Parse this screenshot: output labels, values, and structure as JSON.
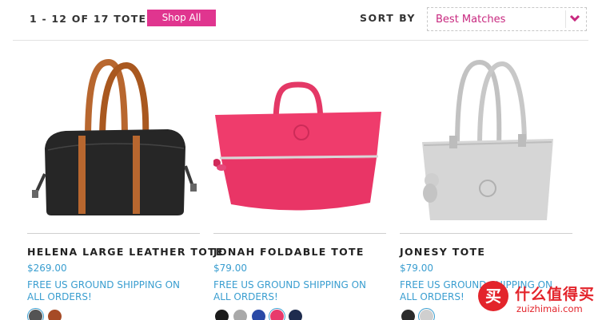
{
  "results": {
    "count_text": "1 - 12 OF 17 TOTES",
    "shop_all_label": "Shop All"
  },
  "sort": {
    "label": "SORT BY",
    "value": "Best Matches"
  },
  "colors": {
    "accent": "#e0358f",
    "link": "#3a9ed0"
  },
  "products": [
    {
      "name": "HELENA LARGE LEATHER TOTE",
      "price": "$269.00",
      "shipping": "FREE US GROUND SHIPPING ON ALL ORDERS!",
      "swatches": [
        "#545454",
        "#a64b26"
      ]
    },
    {
      "name": "JONAH FOLDABLE TOTE",
      "price": "$79.00",
      "shipping": "FREE US GROUND SHIPPING ON ALL ORDERS!",
      "swatches": [
        "#1b1b1b",
        "#a9a9a9",
        "#2a49a6",
        "#e83a6c",
        "#1e2c4e"
      ]
    },
    {
      "name": "JONESY TOTE",
      "price": "$79.00",
      "shipping": "FREE US GROUND SHIPPING ON ALL ORDERS!",
      "swatches": [
        "#2b2b2b",
        "#cfcfcf"
      ]
    }
  ],
  "watermark": {
    "glyph": "买",
    "cn_text": "什么值得买",
    "en_text": "zuizhimai.com"
  }
}
